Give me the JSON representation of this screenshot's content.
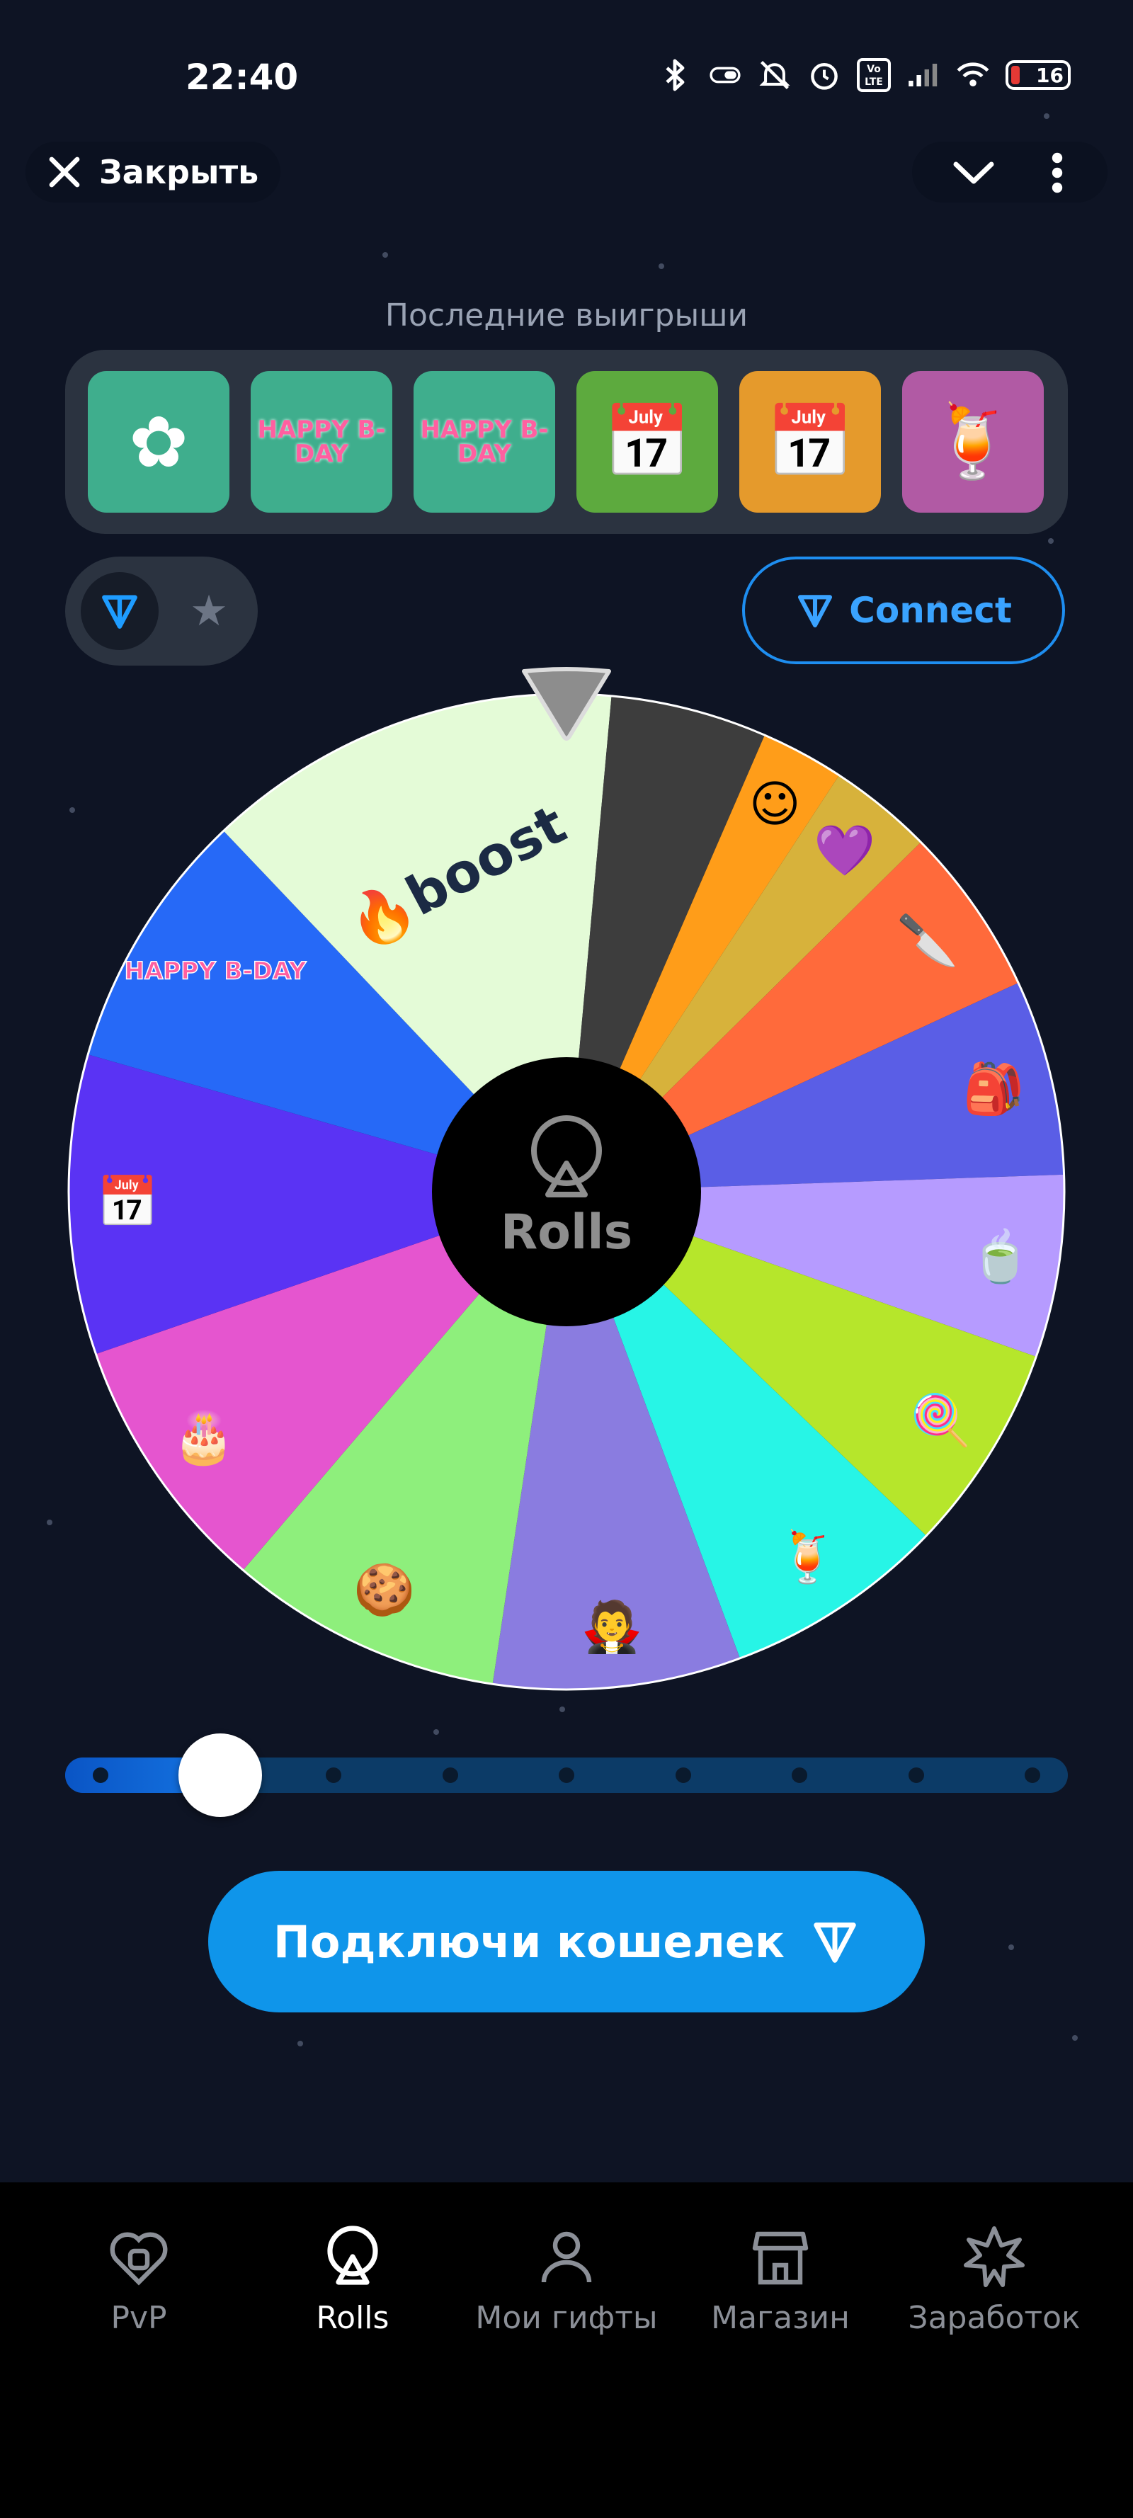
{
  "status": {
    "time": "22:40",
    "battery": "16"
  },
  "header": {
    "close_label": "Закрыть"
  },
  "recent": {
    "title": "Последние выигрыши",
    "items": [
      {
        "name": "pink-flower-gift",
        "bg": "#3fae8d",
        "glyph": "✿",
        "text": ""
      },
      {
        "name": "happy-bday-gift",
        "bg": "#3fae8d",
        "glyph": "",
        "text": "HAPPY B-DAY"
      },
      {
        "name": "happy-bday-gift",
        "bg": "#3fae8d",
        "glyph": "",
        "text": "HAPPY B-DAY"
      },
      {
        "name": "bday-calendar-gift",
        "bg": "#5daa3e",
        "glyph": "📅",
        "text": ""
      },
      {
        "name": "bday-calendar-gift",
        "bg": "#e59a2c",
        "glyph": "📅",
        "text": ""
      },
      {
        "name": "cocktail-gift",
        "bg": "#b15aa4",
        "glyph": "🍹",
        "text": ""
      }
    ]
  },
  "connect": {
    "label": "Connect"
  },
  "wheel": {
    "center_label": "Rolls",
    "boost_label": "boost",
    "segments": [
      {
        "color": "#2669f7",
        "weight": 10,
        "icon": "HAPPY B-DAY"
      },
      {
        "color": "#e4fbd7",
        "weight": 16,
        "icon": "boost"
      },
      {
        "color": "#3d3d3d",
        "weight": 6,
        "icon": ""
      },
      {
        "color": "#ff9d19",
        "weight": 3.2,
        "icon": "☺"
      },
      {
        "color": "#d7b23b",
        "weight": 4,
        "icon": "💜"
      },
      {
        "color": "#ff6a3b",
        "weight": 6.5,
        "icon": "🔪"
      },
      {
        "color": "#5a5ee6",
        "weight": 7.5,
        "icon": "🎒"
      },
      {
        "color": "#b69bff",
        "weight": 7,
        "icon": "🍵"
      },
      {
        "color": "#b6e62b",
        "weight": 8,
        "icon": "🍭"
      },
      {
        "color": "#27f5e6",
        "weight": 8.5,
        "icon": "🍹"
      },
      {
        "color": "#8a7ce0",
        "weight": 9.5,
        "icon": "🧛"
      },
      {
        "color": "#8eef7c",
        "weight": 10.5,
        "icon": "🍪"
      },
      {
        "color": "#e555cf",
        "weight": 10,
        "icon": "🎂"
      },
      {
        "color": "#5a33f4",
        "weight": 11.5,
        "icon": "📅"
      }
    ]
  },
  "slider": {
    "position_fraction": 0.155,
    "steps": 9
  },
  "wallet_button": {
    "label": "Подключи кошелек"
  },
  "tabs": [
    {
      "key": "pvp",
      "label": "PvP",
      "active": false
    },
    {
      "key": "rolls",
      "label": "Rolls",
      "active": true
    },
    {
      "key": "my-gifts",
      "label": "Мои гифты",
      "active": false
    },
    {
      "key": "shop",
      "label": "Магазин",
      "active": false
    },
    {
      "key": "earnings",
      "label": "Заработок",
      "active": false
    }
  ]
}
